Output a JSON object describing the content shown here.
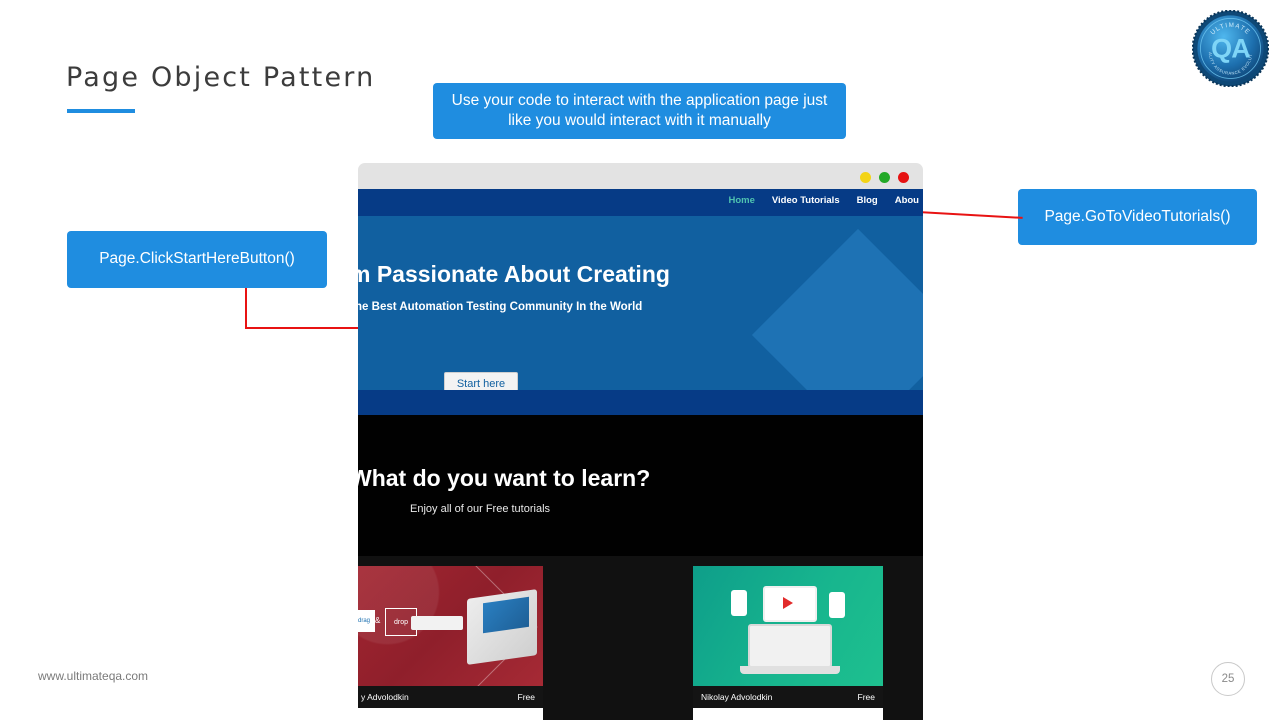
{
  "slide": {
    "title": "Page Object Pattern",
    "site_url": "www.ultimateqa.com",
    "slide_number": "25",
    "accent_color": "#1f8de0",
    "connector_color": "#e81313"
  },
  "callouts": {
    "top": "Use your code to interact with the application page just like you would interact with it manually",
    "left": "Page.ClickStartHereButton()",
    "right": "Page.GoToVideoTutorials()"
  },
  "browser": {
    "window_dots": [
      "yellow",
      "green",
      "red"
    ],
    "nav": {
      "items": [
        {
          "label": "Home",
          "active": true
        },
        {
          "label": "Video Tutorials",
          "active": false
        },
        {
          "label": "Blog",
          "active": false
        },
        {
          "label": "Abou",
          "active": false
        }
      ]
    },
    "hero": {
      "heading": "m Passionate About Creating",
      "subheading": "The Best Automation Testing Community In the World",
      "button_label": "Start here",
      "bg_color": "#1160a0"
    },
    "learn": {
      "heading": "What do you want to learn?",
      "subheading": "Enjoy all of our Free tutorials",
      "bg_color": "#010101"
    },
    "cards": [
      {
        "author": "y Advolodkin",
        "price": "Free",
        "art": "drag-and-drop-illustration",
        "drag_label": "drag",
        "amp_label": "&",
        "drop_label": "drop"
      },
      {
        "author": "Nikolay Advolodkin",
        "price": "Free",
        "art": "video-devices-illustration"
      }
    ]
  },
  "logo": {
    "top_text": "ULTIMATE",
    "main_text": "QA",
    "arc_text": "QUALITY ASSURANCE EVOLUTION"
  }
}
